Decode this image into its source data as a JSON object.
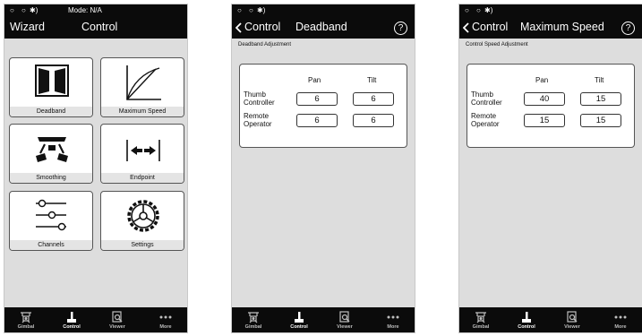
{
  "screens": [
    {
      "status": {
        "dots": "○ ○",
        "bt": "✱)",
        "mode": "Mode: N/A"
      },
      "header": {
        "left": "Wizard",
        "center": "Control"
      },
      "tiles": [
        {
          "label": "Deadband",
          "icon": "deadband-icon"
        },
        {
          "label": "Maximum Speed",
          "icon": "speed-curve-icon"
        },
        {
          "label": "Smoothing",
          "icon": "smoothing-icon"
        },
        {
          "label": "Endpoint",
          "icon": "endpoint-icon"
        },
        {
          "label": "Channels",
          "icon": "sliders-icon"
        },
        {
          "label": "Settings",
          "icon": "gear-icon"
        }
      ]
    },
    {
      "status": {
        "dots": "○ ○",
        "bt": "✱)"
      },
      "header": {
        "back": "Control",
        "title": "Deadband",
        "help": "?"
      },
      "section": "Deadband Adjustment",
      "columns": [
        "Pan",
        "Tilt"
      ],
      "rows": [
        {
          "label1": "Thumb",
          "label2": "Controller",
          "pan": "6",
          "tilt": "6"
        },
        {
          "label1": "Remote",
          "label2": "Operator",
          "pan": "6",
          "tilt": "6"
        }
      ]
    },
    {
      "status": {
        "dots": "○ ○",
        "bt": "✱)"
      },
      "header": {
        "back": "Control",
        "title": "Maximum Speed",
        "help": "?"
      },
      "section": "Control Speed Adjustment",
      "columns": [
        "Pan",
        "Tilt"
      ],
      "rows": [
        {
          "label1": "Thumb",
          "label2": "Controller",
          "pan": "40",
          "tilt": "15"
        },
        {
          "label1": "Remote",
          "label2": "Operator",
          "pan": "15",
          "tilt": "15"
        }
      ]
    }
  ],
  "tabbar": [
    {
      "label": "Gimbal",
      "icon": "gimbal-icon"
    },
    {
      "label": "Control",
      "icon": "joystick-icon",
      "active": true
    },
    {
      "label": "Viewer",
      "icon": "viewer-icon"
    },
    {
      "label": "More",
      "icon": "more-dots-icon"
    }
  ]
}
